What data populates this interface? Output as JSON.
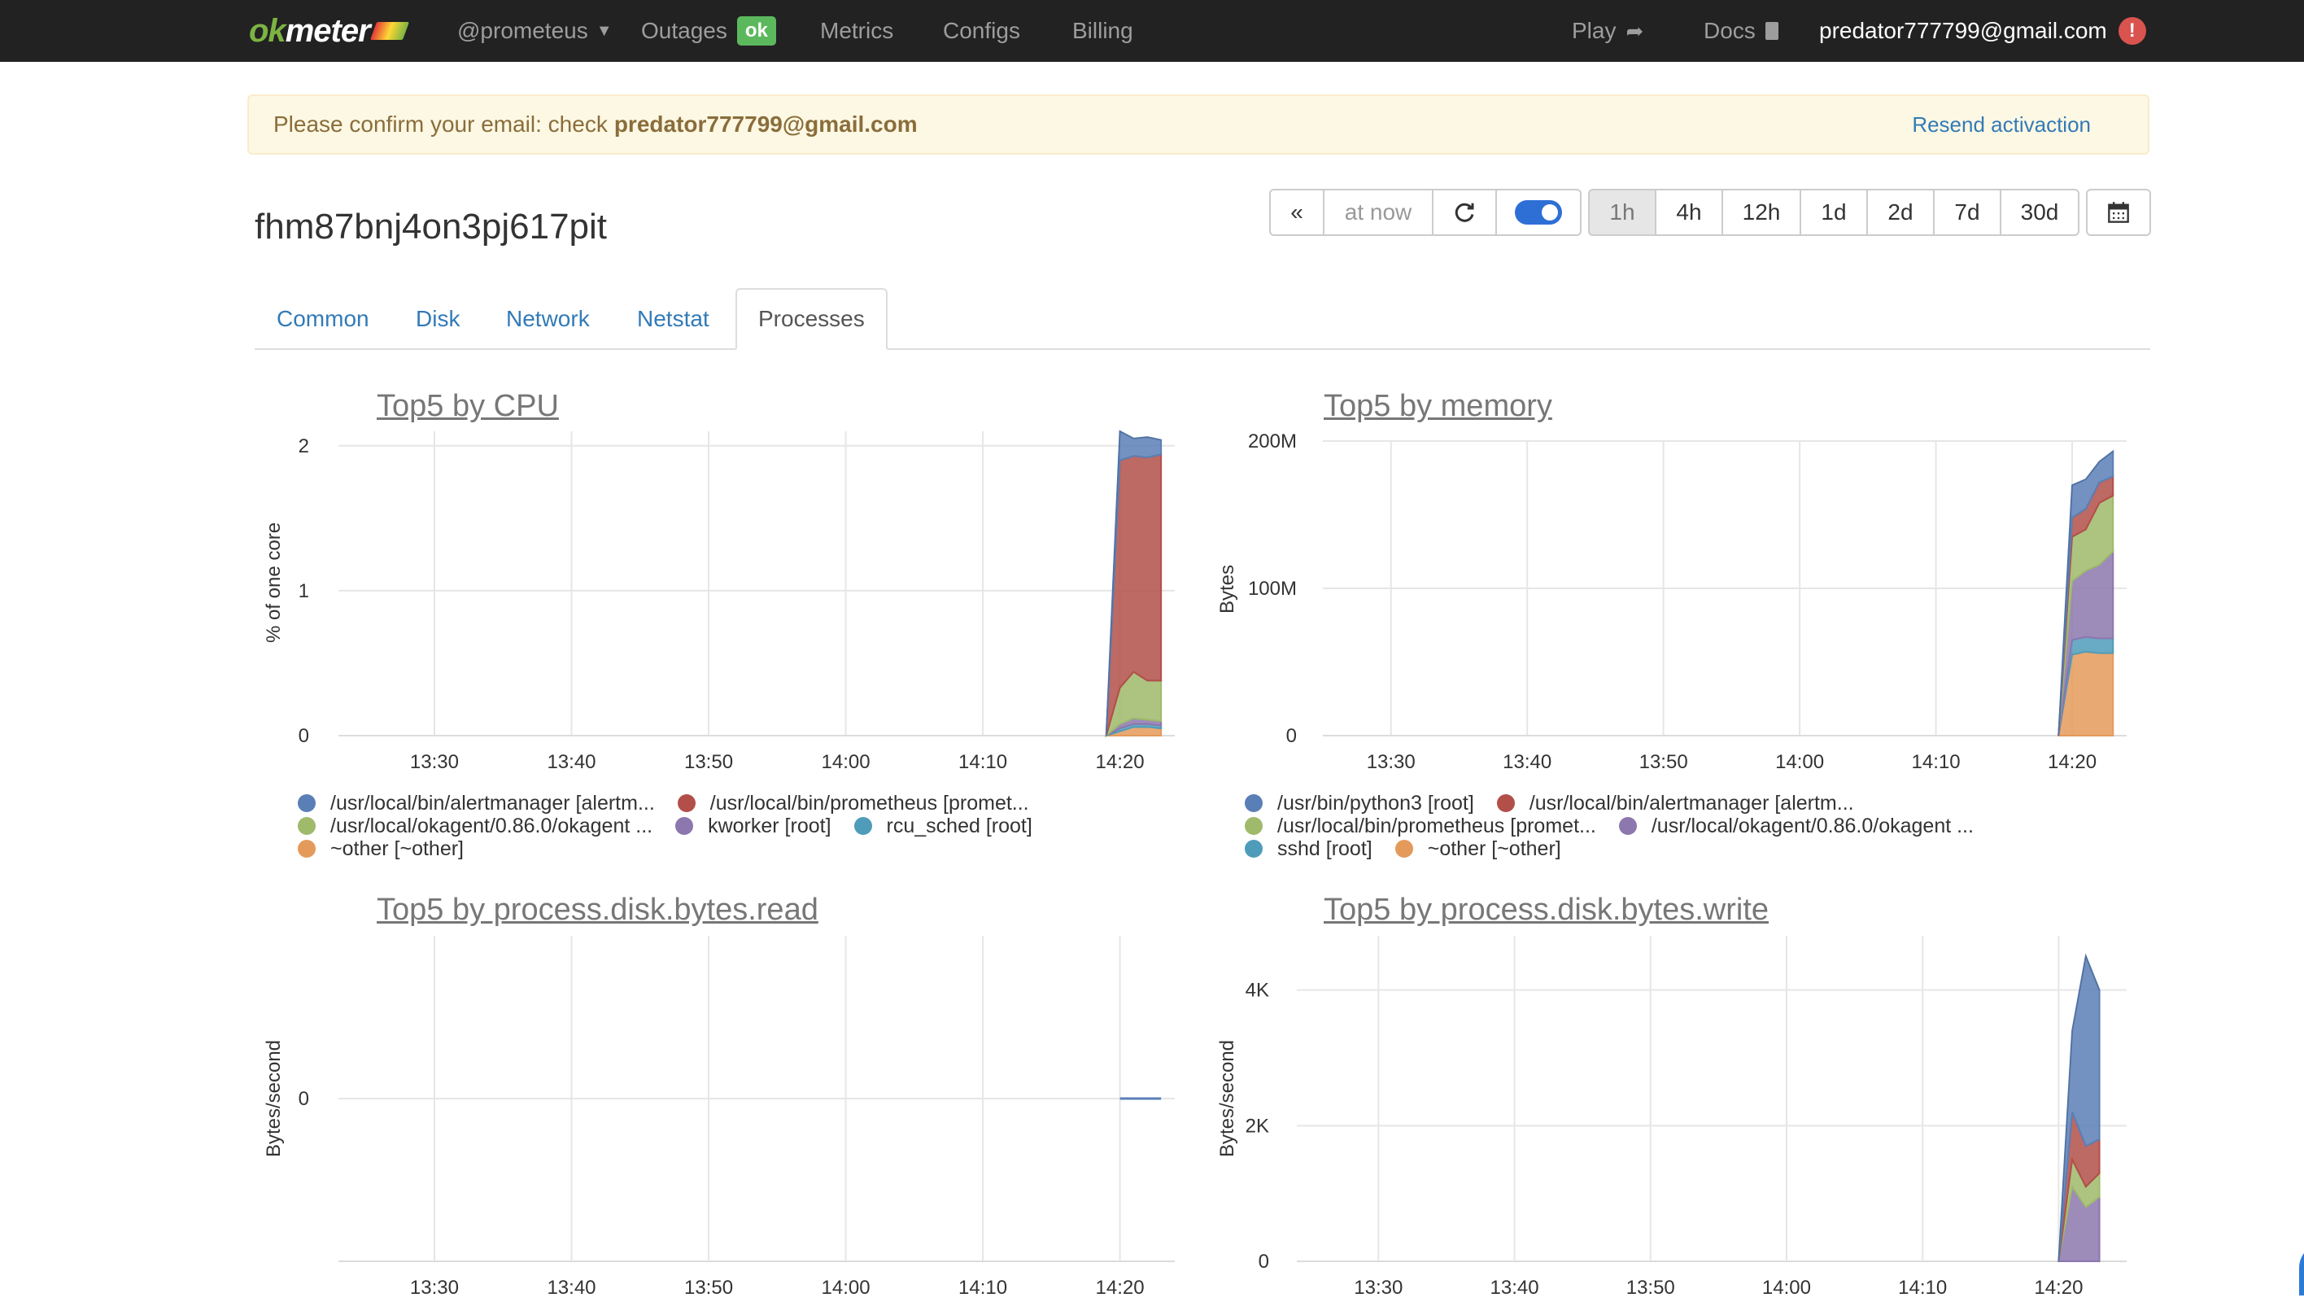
{
  "nav": {
    "logo_ok": "ok",
    "logo_meter": "meter",
    "project": "@prometeus",
    "outages": "Outages",
    "outages_badge": "ok",
    "metrics": "Metrics",
    "configs": "Configs",
    "billing": "Billing",
    "play": "Play",
    "docs": "Docs",
    "user": "predator777799@gmail.com",
    "alert": "!"
  },
  "banner": {
    "message": "Please confirm your email: check",
    "email": "predator777799@gmail.com",
    "resend": "Resend activaction"
  },
  "host": {
    "title": "fhm87bnj4on3pj617pit"
  },
  "timebar": {
    "back": "«",
    "at_now": "at now",
    "refresh_icon": "refresh-icon",
    "live_toggle_on": true,
    "ranges": [
      "1h",
      "4h",
      "12h",
      "1d",
      "2d",
      "7d",
      "30d"
    ],
    "active_range": "1h",
    "calendar_icon": "calendar-icon"
  },
  "tabs": [
    "Common",
    "Disk",
    "Network",
    "Netstat",
    "Processes"
  ],
  "active_tab": "Processes",
  "colors": {
    "blue": "#5a7fb6",
    "red": "#b24f49",
    "green": "#9fba6b",
    "purple": "#8c77ae",
    "teal": "#4f9cba",
    "orange": "#e49a5b"
  },
  "chart_data": [
    {
      "type": "area",
      "title": "Top5 by CPU",
      "ylabel": "% of one core",
      "x": [
        "14:19",
        "14:20",
        "14:21",
        "14:22",
        "14:23"
      ],
      "xticks": [
        "13:30",
        "13:40",
        "13:50",
        "14:00",
        "14:10",
        "14:20"
      ],
      "yticks": [
        "0",
        "1",
        "2"
      ],
      "ylim": [
        0,
        2.1
      ],
      "stacked": true,
      "series": [
        {
          "name": "~other [~other]",
          "color": "#e49a5b",
          "values": [
            0,
            0.03,
            0.06,
            0.06,
            0.05
          ]
        },
        {
          "name": "rcu_sched [root]",
          "color": "#4f9cba",
          "values": [
            0,
            0.02,
            0.02,
            0.02,
            0.02
          ]
        },
        {
          "name": "kworker [root]",
          "color": "#8c77ae",
          "values": [
            0,
            0.03,
            0.04,
            0.03,
            0.03
          ]
        },
        {
          "name": "/usr/local/okagent/0.86.0/okagent ...",
          "color": "#9fba6b",
          "values": [
            0,
            0.25,
            0.32,
            0.27,
            0.28
          ]
        },
        {
          "name": "/usr/local/bin/prometheus [promet...",
          "color": "#b24f49",
          "values": [
            0,
            1.57,
            1.49,
            1.54,
            1.56
          ]
        },
        {
          "name": "/usr/local/bin/alertmanager [alertm...",
          "color": "#5a7fb6",
          "values": [
            0,
            0.2,
            0.12,
            0.14,
            0.1
          ]
        }
      ],
      "legend": [
        [
          [
            "/usr/local/bin/alertmanager [alertm...",
            "#5a7fb6"
          ],
          [
            "/usr/local/bin/prometheus [promet...",
            "#b24f49"
          ]
        ],
        [
          [
            "/usr/local/okagent/0.86.0/okagent ...",
            "#9fba6b"
          ],
          [
            "kworker [root]",
            "#8c77ae"
          ],
          [
            "rcu_sched [root]",
            "#4f9cba"
          ]
        ],
        [
          [
            "~other [~other]",
            "#e49a5b"
          ]
        ]
      ]
    },
    {
      "type": "area",
      "title": "Top5 by memory",
      "ylabel": "Bytes",
      "x": [
        "14:19",
        "14:20",
        "14:21",
        "14:22",
        "14:23"
      ],
      "xticks": [
        "13:30",
        "13:40",
        "13:50",
        "14:00",
        "14:10",
        "14:20"
      ],
      "yticks": [
        "0",
        "100M",
        "200M"
      ],
      "ylim": [
        0,
        200
      ],
      "stacked": true,
      "series": [
        {
          "name": "~other [~other]",
          "color": "#e49a5b",
          "values": [
            0,
            55,
            57,
            56,
            56
          ]
        },
        {
          "name": "sshd [root]",
          "color": "#4f9cba",
          "values": [
            0,
            10,
            10,
            10,
            10
          ]
        },
        {
          "name": "/usr/local/okagent/0.86.0/okagent ...",
          "color": "#8c77ae",
          "values": [
            0,
            40,
            45,
            50,
            59
          ]
        },
        {
          "name": "/usr/local/bin/prometheus [promet...",
          "color": "#9fba6b",
          "values": [
            0,
            30,
            28,
            42,
            38
          ]
        },
        {
          "name": "/usr/local/bin/alertmanager [alertm...",
          "color": "#b24f49",
          "values": [
            0,
            13,
            14,
            14,
            13
          ]
        },
        {
          "name": "/usr/bin/python3 [root]",
          "color": "#5a7fb6",
          "values": [
            0,
            22,
            20,
            14,
            17
          ]
        }
      ],
      "legend": [
        [
          [
            "/usr/bin/python3 [root]",
            "#5a7fb6"
          ],
          [
            "/usr/local/bin/alertmanager [alertm...",
            "#b24f49"
          ]
        ],
        [
          [
            "/usr/local/bin/prometheus [promet...",
            "#9fba6b"
          ],
          [
            "/usr/local/okagent/0.86.0/okagent ...",
            "#8c77ae"
          ]
        ],
        [
          [
            "sshd [root]",
            "#4f9cba"
          ],
          [
            "~other [~other]",
            "#e49a5b"
          ]
        ]
      ]
    },
    {
      "type": "line",
      "title": "Top5 by process.disk.bytes.read",
      "ylabel": "Bytes/second",
      "x": [
        "14:20",
        "14:23"
      ],
      "xticks": [
        "13:30",
        "13:40",
        "13:50",
        "14:00",
        "14:10",
        "14:20"
      ],
      "yticks": [
        "0"
      ],
      "ylim": [
        -1,
        1
      ],
      "stacked": false,
      "series": [
        {
          "name": "",
          "color": "#5a7fb6",
          "values": [
            0,
            0
          ]
        }
      ],
      "legend": []
    },
    {
      "type": "area",
      "title": "Top5 by process.disk.bytes.write",
      "ylabel": "Bytes/second",
      "x": [
        "14:20",
        "14:21",
        "14:22",
        "14:23"
      ],
      "xticks": [
        "13:30",
        "13:40",
        "13:50",
        "14:00",
        "14:10",
        "14:20"
      ],
      "yticks": [
        "0",
        "2K",
        "4K"
      ],
      "ylim": [
        0,
        4.8
      ],
      "stacked": true,
      "series": [
        {
          "name": "",
          "color": "#8c77ae",
          "values": [
            0,
            1.1,
            0.8,
            0.95
          ]
        },
        {
          "name": "",
          "color": "#9fba6b",
          "values": [
            0,
            0.4,
            0.3,
            0.35
          ]
        },
        {
          "name": "",
          "color": "#b24f49",
          "values": [
            0,
            0.7,
            0.6,
            0.5
          ]
        },
        {
          "name": "",
          "color": "#5a7fb6",
          "values": [
            0,
            1.2,
            2.8,
            2.2
          ]
        }
      ],
      "legend": []
    }
  ]
}
